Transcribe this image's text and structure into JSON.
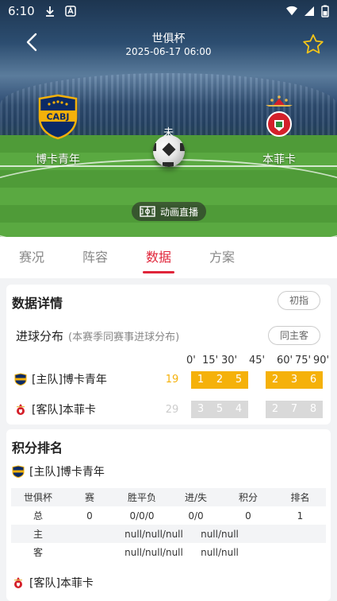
{
  "status_bar": {
    "time": "6:10"
  },
  "header": {
    "league": "世俱杯",
    "datetime": "2025-06-17 06:00",
    "match_status": "未",
    "animation_label": "动画直播"
  },
  "home_team": {
    "name": "博卡青年",
    "logo_text": "CABJ"
  },
  "away_team": {
    "name": "本菲卡"
  },
  "tabs": [
    {
      "label": "赛况"
    },
    {
      "label": "阵容"
    },
    {
      "label": "数据"
    },
    {
      "label": "方案"
    }
  ],
  "active_tab": "数据",
  "data_detail": {
    "title": "数据详情",
    "button": "初指"
  },
  "goal_distribution": {
    "title": "进球分布",
    "note": "(本赛季同赛事进球分布)",
    "button": "同主客",
    "minutes": [
      "0'",
      "15'",
      "30'",
      "45'",
      "60'",
      "75'",
      "90'"
    ],
    "home": {
      "label": "[主队]博卡青年",
      "total": "19",
      "first_half": [
        "1",
        "2",
        "5"
      ],
      "second_half": [
        "2",
        "3",
        "6"
      ]
    },
    "away": {
      "label": "[客队]本菲卡",
      "total": "29",
      "first_half": [
        "3",
        "5",
        "4"
      ],
      "second_half": [
        "2",
        "7",
        "8"
      ]
    }
  },
  "standings": {
    "title": "积分排名",
    "home_label": "[主队]博卡青年",
    "away_label": "[客队]本菲卡",
    "headers": [
      "世俱杯",
      "赛",
      "胜平负",
      "进/失",
      "积分",
      "排名"
    ],
    "rows": [
      [
        "总",
        "0",
        "0/0/0",
        "0/0",
        "0",
        "1"
      ],
      [
        "主",
        "",
        "null/null/null",
        "null/null",
        "",
        ""
      ],
      [
        "客",
        "",
        "null/null/null",
        "null/null",
        "",
        ""
      ]
    ]
  },
  "colors": {
    "accent": "#e0253a",
    "home_cell": "#f5b10a",
    "away_cell": "#d9d9d9"
  }
}
